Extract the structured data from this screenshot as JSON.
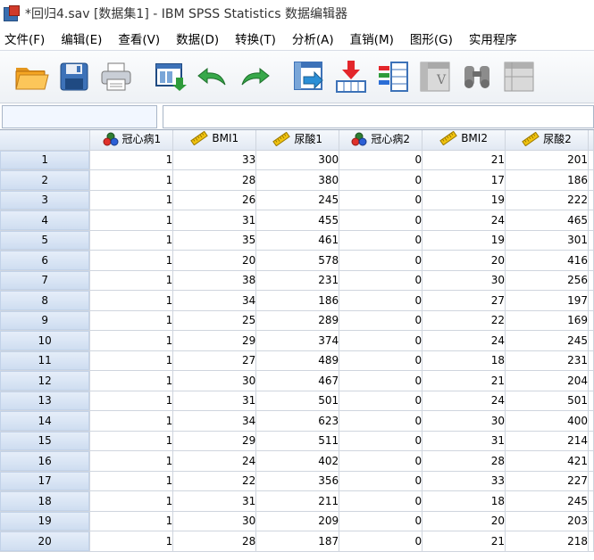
{
  "window": {
    "title": "*回归4.sav [数据集1] - IBM SPSS Statistics 数据编辑器"
  },
  "menu": [
    "文件(F)",
    "编辑(E)",
    "查看(V)",
    "数据(D)",
    "转换(T)",
    "分析(A)",
    "直销(M)",
    "图形(G)",
    "实用程序"
  ],
  "toolbar": [
    {
      "name": "open-folder-icon"
    },
    {
      "name": "save-icon"
    },
    {
      "name": "print-icon"
    },
    {
      "name": "recall-dialog-icon"
    },
    {
      "name": "undo-icon"
    },
    {
      "name": "redo-icon"
    },
    {
      "name": "goto-case-icon"
    },
    {
      "name": "goto-variable-icon"
    },
    {
      "name": "variables-icon"
    },
    {
      "name": "run-descriptives-icon"
    },
    {
      "name": "find-icon"
    },
    {
      "name": "insert-cases-icon"
    }
  ],
  "editbar": {
    "cell_reference": "",
    "cell_value": ""
  },
  "colors": {
    "nominal_measure": "#2e7d32",
    "scale_measure": "#f2b705",
    "row_header": "#cddcf0"
  },
  "columns": [
    {
      "name": "冠心病1",
      "measure": "nominal"
    },
    {
      "name": "BMI1",
      "measure": "scale"
    },
    {
      "name": "尿酸1",
      "measure": "scale"
    },
    {
      "name": "冠心病2",
      "measure": "nominal"
    },
    {
      "name": "BMI2",
      "measure": "scale"
    },
    {
      "name": "尿酸2",
      "measure": "scale"
    }
  ],
  "rows": [
    {
      "n": "1",
      "v": [
        "1",
        "33",
        "300",
        "0",
        "21",
        "201"
      ]
    },
    {
      "n": "2",
      "v": [
        "1",
        "28",
        "380",
        "0",
        "17",
        "186"
      ]
    },
    {
      "n": "3",
      "v": [
        "1",
        "26",
        "245",
        "0",
        "19",
        "222"
      ]
    },
    {
      "n": "4",
      "v": [
        "1",
        "31",
        "455",
        "0",
        "24",
        "465"
      ]
    },
    {
      "n": "5",
      "v": [
        "1",
        "35",
        "461",
        "0",
        "19",
        "301"
      ]
    },
    {
      "n": "6",
      "v": [
        "1",
        "20",
        "578",
        "0",
        "20",
        "416"
      ]
    },
    {
      "n": "7",
      "v": [
        "1",
        "38",
        "231",
        "0",
        "30",
        "256"
      ]
    },
    {
      "n": "8",
      "v": [
        "1",
        "34",
        "186",
        "0",
        "27",
        "197"
      ]
    },
    {
      "n": "9",
      "v": [
        "1",
        "25",
        "289",
        "0",
        "22",
        "169"
      ]
    },
    {
      "n": "10",
      "v": [
        "1",
        "29",
        "374",
        "0",
        "24",
        "245"
      ]
    },
    {
      "n": "11",
      "v": [
        "1",
        "27",
        "489",
        "0",
        "18",
        "231"
      ]
    },
    {
      "n": "12",
      "v": [
        "1",
        "30",
        "467",
        "0",
        "21",
        "204"
      ]
    },
    {
      "n": "13",
      "v": [
        "1",
        "31",
        "501",
        "0",
        "24",
        "501"
      ]
    },
    {
      "n": "14",
      "v": [
        "1",
        "34",
        "623",
        "0",
        "30",
        "400"
      ]
    },
    {
      "n": "15",
      "v": [
        "1",
        "29",
        "511",
        "0",
        "31",
        "214"
      ]
    },
    {
      "n": "16",
      "v": [
        "1",
        "24",
        "402",
        "0",
        "28",
        "421"
      ]
    },
    {
      "n": "17",
      "v": [
        "1",
        "22",
        "356",
        "0",
        "33",
        "227"
      ]
    },
    {
      "n": "18",
      "v": [
        "1",
        "31",
        "211",
        "0",
        "18",
        "245"
      ]
    },
    {
      "n": "19",
      "v": [
        "1",
        "30",
        "209",
        "0",
        "20",
        "203"
      ]
    },
    {
      "n": "20",
      "v": [
        "1",
        "28",
        "187",
        "0",
        "21",
        "218"
      ]
    }
  ]
}
